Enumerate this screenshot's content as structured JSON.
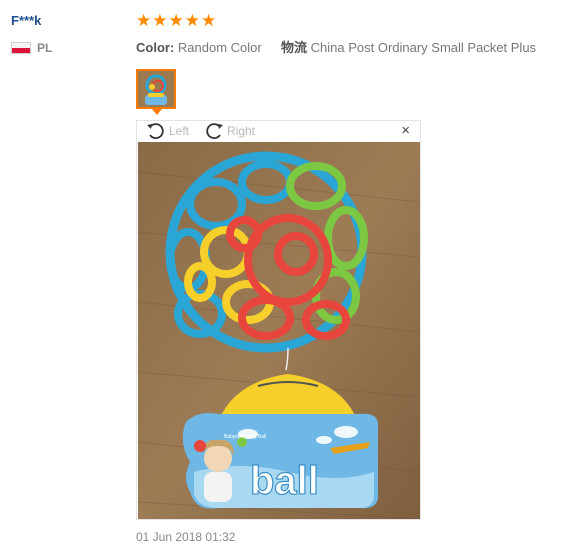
{
  "review": {
    "user_name": "F***k",
    "country_code": "PL",
    "rating": 5,
    "color_label": "Color:",
    "color_value": "Random Color",
    "shipping_label": "物流",
    "shipping_value": "China Post Ordinary Small Packet Plus",
    "date": "01 Jun 2018 01:32"
  },
  "viewer": {
    "rotate_left_label": "Left",
    "rotate_right_label": "Right",
    "close_label": "×"
  },
  "product_photo": {
    "packaging_text": "ball"
  },
  "colors": {
    "user_name": "#1f4e8c",
    "star": "#ff8a00",
    "thumb_border": "#ff7a00",
    "ball_blue": "#2aa6d6",
    "ball_green": "#7cc842",
    "ball_red": "#e8453c",
    "ball_yellow": "#f6cf2a"
  },
  "icons": {
    "flag": "poland-flag-icon",
    "star": "star-icon",
    "rotate_left": "rotate-left-icon",
    "rotate_right": "rotate-right-icon",
    "close": "close-icon"
  }
}
